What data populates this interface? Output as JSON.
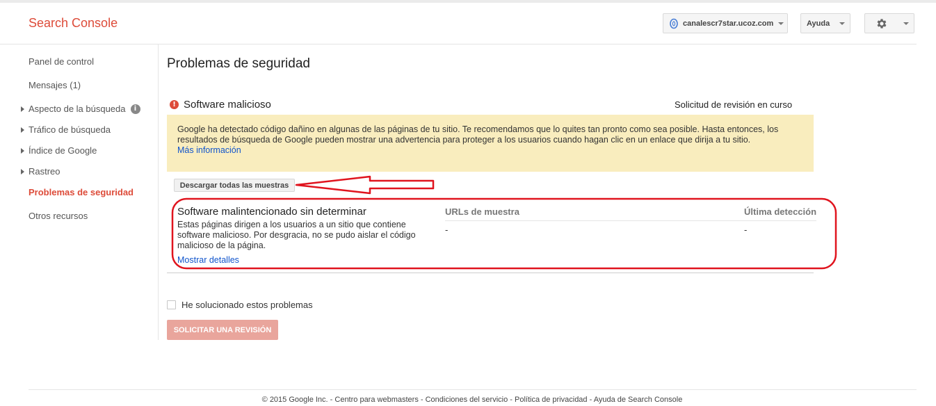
{
  "header": {
    "brand": "Search Console",
    "site": "canalescr7star.ucoz.com",
    "help_label": "Ayuda"
  },
  "sidebar": {
    "items": [
      {
        "label": "Panel de control"
      },
      {
        "label": "Mensajes (1)"
      },
      {
        "label": "Aspecto de la búsqueda"
      },
      {
        "label": "Tráfico de búsqueda"
      },
      {
        "label": "Índice de Google"
      },
      {
        "label": "Rastreo"
      },
      {
        "label": "Problemas de seguridad"
      },
      {
        "label": "Otros recursos"
      }
    ]
  },
  "main": {
    "page_title": "Problemas de seguridad",
    "issue_title": "Software malicioso",
    "review_status": "Solicitud de revisión en curso",
    "warning_text": "Google ha detectado código dañino en algunas de las páginas de tu sitio. Te recomendamos que lo quites tan pronto como sea posible. Hasta entonces, los resultados de búsqueda de Google pueden mostrar una advertencia para proteger a los usuarios cuando hagan clic en un enlace que dirija a tu sitio.",
    "more_info": "Más información",
    "download_button": "Descargar todas las muestras",
    "sample": {
      "title": "Software malintencionado sin determinar",
      "description": "Estas páginas dirigen a los usuarios a un sitio que contiene software malicioso. Por desgracia, no se pudo aislar el código malicioso de la página.",
      "show_details": "Mostrar detalles",
      "col_urls": "URLs de muestra",
      "col_last": "Última detección",
      "url_value": "-",
      "last_value": "-"
    },
    "fixed_label": "He solucionado estos problemas",
    "request_button": "SOLICITAR UNA REVISIÓN"
  },
  "footer": {
    "text": "© 2015 Google Inc. - Centro para webmasters - Condiciones del servicio - Política de privacidad - Ayuda de Search Console"
  },
  "colors": {
    "brand": "#dd4b39",
    "link": "#1155cc",
    "warning_bg": "#f9edbe",
    "annotation": "#e0141e"
  },
  "icons": [
    "site-globe-icon",
    "chevron-down-icon",
    "gear-icon",
    "info-icon",
    "error-icon",
    "arrow-annotation",
    "oval-annotation"
  ]
}
